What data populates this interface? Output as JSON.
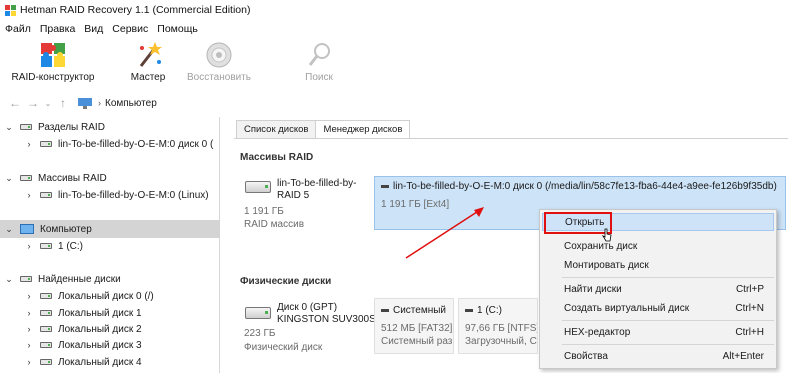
{
  "window": {
    "title": "Hetman RAID Recovery 1.1 (Commercial Edition)"
  },
  "menu": [
    "Файл",
    "Правка",
    "Вид",
    "Сервис",
    "Помощь"
  ],
  "ribbon": {
    "raid_builder": "RAID-конструктор",
    "wizard": "Мастер",
    "restore": "Восстановить",
    "search": "Поиск"
  },
  "address": {
    "crumb": "Компьютер"
  },
  "tree": {
    "raid_partitions": "Разделы RAID",
    "raid_partitions_child": "lin-To-be-filled-by-O-E-M:0 диск 0 (",
    "raid_arrays": "Массивы RAID",
    "raid_arrays_child": "lin-To-be-filled-by-O-E-M:0 (Linux)",
    "computer": "Компьютер",
    "computer_child": "1 (C:)",
    "found_disks": "Найденные диски",
    "found_items": [
      "Локальный диск 0 (/)",
      "Локальный диск 1",
      "Локальный диск 2",
      "Локальный диск 3",
      "Локальный диск 4"
    ]
  },
  "tabs": {
    "disk_list": "Список дисков",
    "disk_manager": "Менеджер дисков"
  },
  "raid_section": {
    "title": "Массивы RAID",
    "name_line1": "lin-To-be-filled-by-",
    "name_line2": "RAID 5",
    "size": "1 191 ГБ",
    "type": "RAID массив",
    "partition_name": "lin-To-be-filled-by-O-E-M:0 диск 0 (/media/lin/58c7fe13-fba6-44e4-a9ee-fe126b9f35db)",
    "partition_info": "1 191 ГБ [Ext4]"
  },
  "physical_section": {
    "title": "Физические диски",
    "disk_name": "Диск 0 (GPT)",
    "disk_model": "KINGSTON SUV300S",
    "disk_size": "223 ГБ",
    "disk_type": "Физический диск",
    "part1_name": "Системный",
    "part1_info": "512 МБ [FAT32]",
    "part1_desc": "Системный раз",
    "part2_name": "1 (C:)",
    "part2_info": "97,66 ГБ [NTFS]",
    "part2_desc": "Загрузочный, С"
  },
  "context_menu": {
    "open": "Открыть",
    "save_disk": "Сохранить диск",
    "mount_disk": "Монтировать диск",
    "find_disks": "Найти диски",
    "find_disks_key": "Ctrl+P",
    "create_vdisk": "Создать виртуальный диск",
    "create_vdisk_key": "Ctrl+N",
    "hex_editor": "HEX-редактор",
    "hex_editor_key": "Ctrl+H",
    "properties": "Свойства",
    "properties_key": "Alt+Enter"
  },
  "colors": {
    "selection": "#cde3f7",
    "highlight_outline": "#e01010",
    "annotation_arrow": "#e01010"
  }
}
